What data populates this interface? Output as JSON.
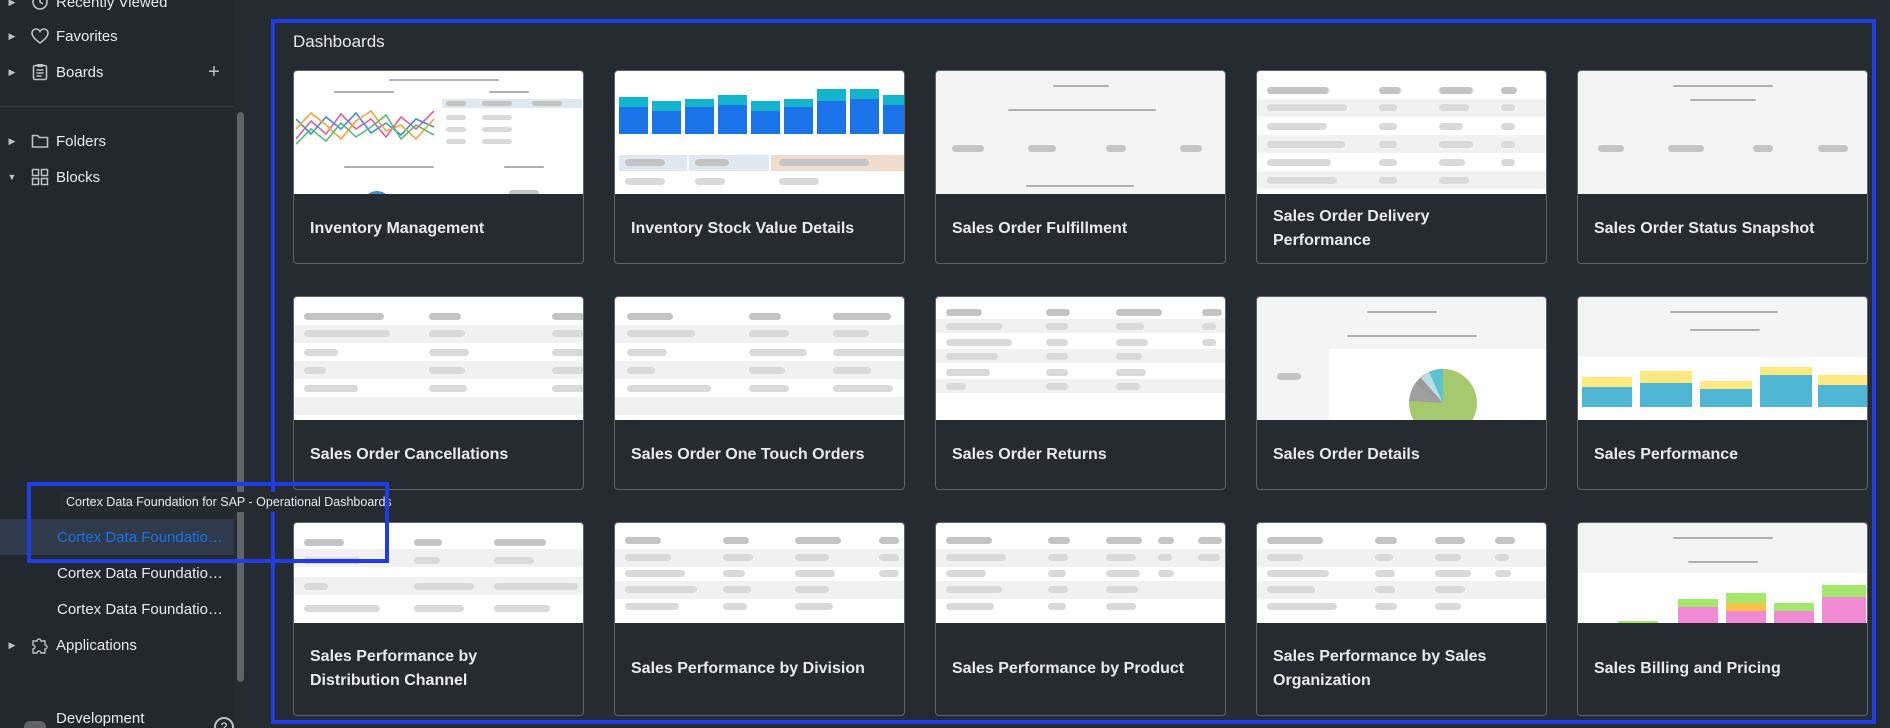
{
  "sidebar": {
    "recently_viewed": "Recently Viewed",
    "favorites": "Favorites",
    "boards": "Boards",
    "folders": "Folders",
    "blocks": "Blocks",
    "cortex_items": [
      "Cortex Data Foundation for SAP - Operational Dashboards",
      "Cortex Data Foundation for SAP - Operational Dashboards",
      "Cortex Data Foundation for SAP - Operational Dashboards"
    ],
    "tooltip": "Cortex Data Foundation for SAP - Operational Dashboards",
    "applications": "Applications",
    "development_mode": "Development Mode"
  },
  "main": {
    "section_title": "Dashboards",
    "cards": [
      {
        "title": "Inventory Management"
      },
      {
        "title": "Inventory Stock Value Details"
      },
      {
        "title": "Sales Order Fulfillment"
      },
      {
        "title": "Sales Order Delivery Performance"
      },
      {
        "title": "Sales Order Status Snapshot"
      },
      {
        "title": "Sales Order Cancellations"
      },
      {
        "title": "Sales Order One Touch Orders"
      },
      {
        "title": "Sales Order Returns"
      },
      {
        "title": "Sales Order Details"
      },
      {
        "title": "Sales Performance"
      },
      {
        "title": "Sales Performance by Distribution Channel"
      },
      {
        "title": "Sales Performance by Division"
      },
      {
        "title": "Sales Performance by Product"
      },
      {
        "title": "Sales Performance by Sales Organization"
      },
      {
        "title": "Sales Billing and Pricing"
      }
    ]
  },
  "colors": {
    "highlight": "#1f3de5",
    "active_link": "#1a73e8",
    "background": "#262b31"
  }
}
